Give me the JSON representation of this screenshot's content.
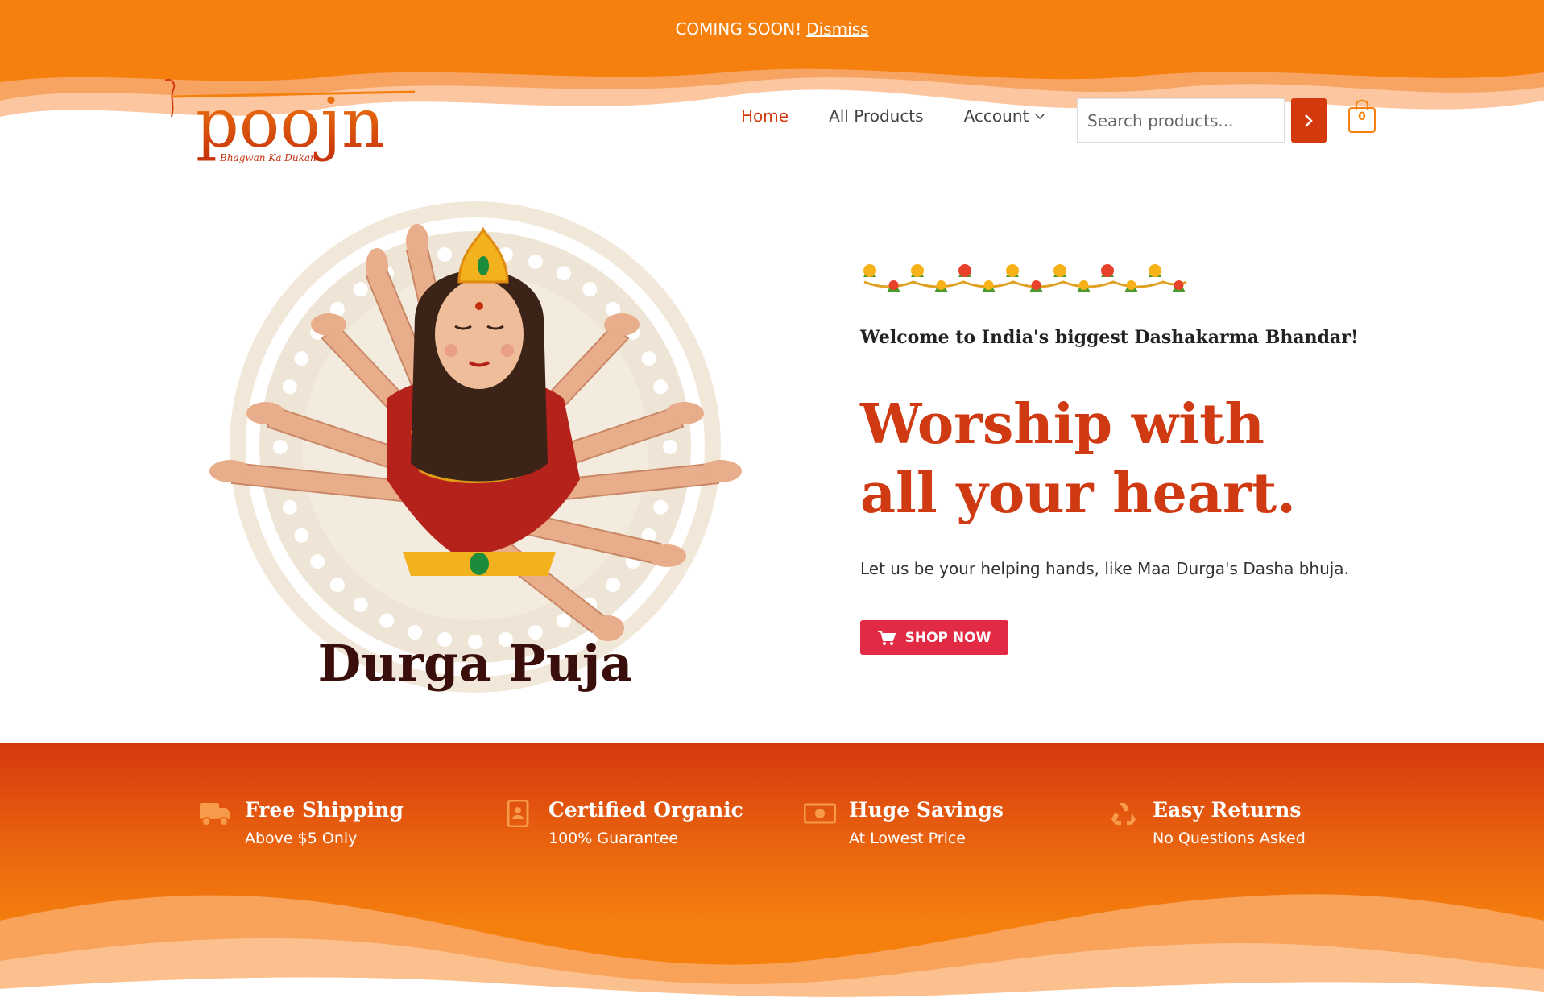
{
  "notice": {
    "text": "COMING SOON!",
    "dismiss": "Dismiss"
  },
  "logo": {
    "text": "poojn",
    "tagline": "Bhagwan Ka Dukan"
  },
  "nav": {
    "items": [
      {
        "label": "Home",
        "active": true
      },
      {
        "label": "All Products",
        "active": false
      },
      {
        "label": "Account",
        "active": false
      }
    ]
  },
  "search": {
    "placeholder": "Search products..."
  },
  "cart": {
    "count": "0"
  },
  "hero": {
    "art_caption": "Durga Puja",
    "welcome": "Welcome to India's biggest Dashakarma Bhandar!",
    "headline": "Worship with all your heart.",
    "subtext": "Let us be your helping hands, like Maa Durga's Dasha bhuja.",
    "button": "SHOP NOW"
  },
  "features": [
    {
      "icon": "truck-icon",
      "title": "Free Shipping",
      "subtitle": "Above $5 Only"
    },
    {
      "icon": "contact-book-icon",
      "title": "Certified Organic",
      "subtitle": "100% Guarantee"
    },
    {
      "icon": "money-icon",
      "title": "Huge Savings",
      "subtitle": "At Lowest Price"
    },
    {
      "icon": "recycle-icon",
      "title": "Easy Returns",
      "subtitle": "No Questions Asked"
    }
  ],
  "colors": {
    "primary_orange": "#f5800e",
    "accent_red": "#d4380d",
    "button_red": "#e32a45",
    "headline_red": "#cf3a12"
  }
}
